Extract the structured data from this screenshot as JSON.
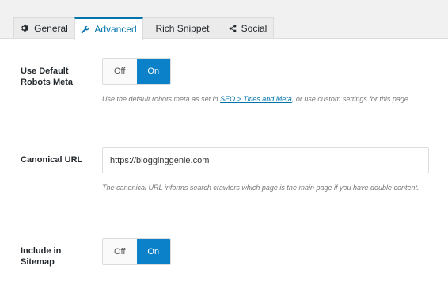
{
  "tabs": [
    {
      "label": "General",
      "icon": "gear-icon",
      "active": false
    },
    {
      "label": "Advanced",
      "icon": "wrench-icon",
      "active": true
    },
    {
      "label": "Rich Snippet",
      "icon": "",
      "active": false
    },
    {
      "label": "Social",
      "icon": "share-icon",
      "active": false
    }
  ],
  "robots_meta": {
    "label": "Use Default Robots Meta",
    "off_label": "Off",
    "on_label": "On",
    "selected": "On",
    "desc_before": "Use the default robots meta as set in ",
    "desc_link": "SEO > Titles and Meta",
    "desc_after": ", or use custom settings for this page."
  },
  "canonical": {
    "label": "Canonical URL",
    "value": "https://blogginggenie.com",
    "description": "The canonical URL informs search crawlers which page is the main page if you have double content."
  },
  "sitemap": {
    "label": "Include in Sitemap",
    "off_label": "Off",
    "on_label": "On",
    "selected": "On"
  },
  "colors": {
    "accent": "#0073aa",
    "toggle_on": "#0a81c9"
  }
}
